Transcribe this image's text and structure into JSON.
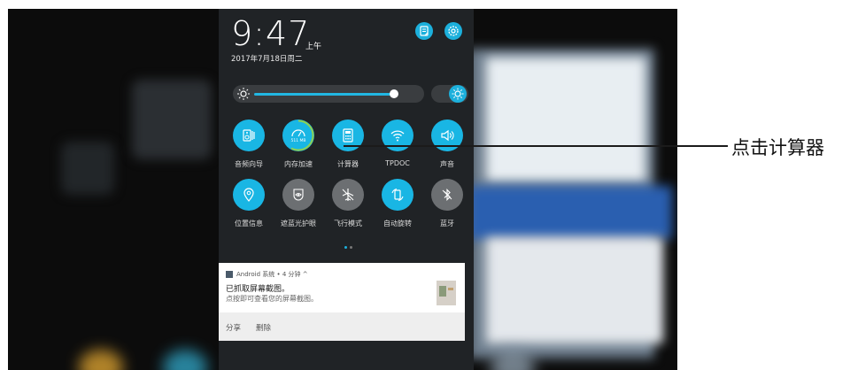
{
  "status": {
    "time": "9:47",
    "ampm": "上午",
    "date": "2017年7月18日周二"
  },
  "header_buttons": [
    {
      "icon": "edit-icon"
    },
    {
      "icon": "settings-icon"
    }
  ],
  "brightness": {
    "level_percent": 88,
    "auto_icon": "sun-auto-icon"
  },
  "quick_settings": [
    {
      "label": "音频向导",
      "icon": "speaker-grid-icon",
      "state": "on"
    },
    {
      "label": "内存加速",
      "icon": "speedometer-icon",
      "state": "on",
      "sub": "511 MB"
    },
    {
      "label": "计算器",
      "icon": "calculator-icon",
      "state": "on"
    },
    {
      "label": "TPDOC",
      "icon": "wifi-icon",
      "state": "on"
    },
    {
      "label": "声音",
      "icon": "volume-icon",
      "state": "on"
    },
    {
      "label": "位置信息",
      "icon": "location-icon",
      "state": "on"
    },
    {
      "label": "遮蓝光护眼",
      "icon": "eye-icon",
      "state": "off"
    },
    {
      "label": "飞行模式",
      "icon": "airplane-icon",
      "state": "off"
    },
    {
      "label": "自动旋转",
      "icon": "rotate-icon",
      "state": "on"
    },
    {
      "label": "蓝牙",
      "icon": "bluetooth-off-icon",
      "state": "off"
    }
  ],
  "notification": {
    "app_line": "Android 系统 • 4 分钟 ^",
    "title": "已抓取屏幕截图。",
    "body": "点按即可查看您的屏幕截图。",
    "actions": [
      "分享",
      "删除"
    ]
  },
  "annotation": {
    "text": "点击计算器"
  },
  "colors": {
    "accent": "#19b6e4",
    "off": "#6c6f72",
    "shade": "#202326"
  }
}
